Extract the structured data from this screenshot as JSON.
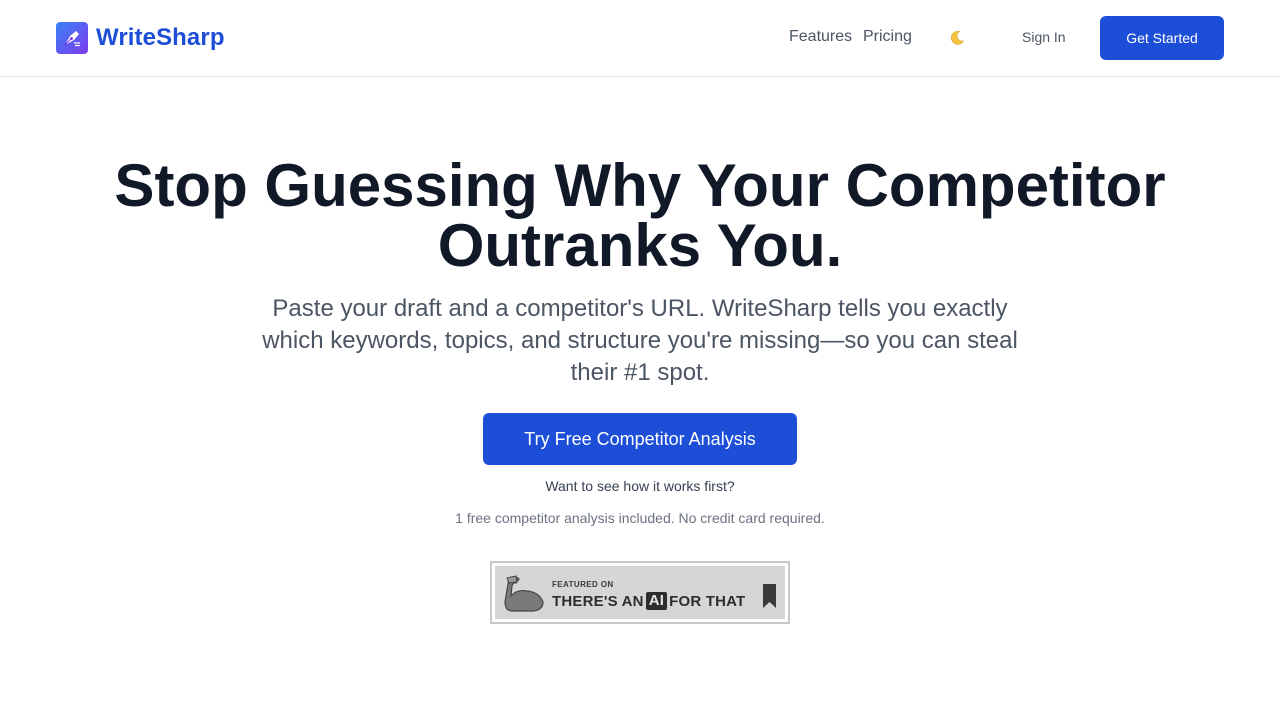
{
  "header": {
    "brand_name": "WriteSharp",
    "nav": {
      "features": "Features",
      "pricing": "Pricing"
    },
    "theme_toggle_icon": "moon-icon",
    "sign_in": "Sign In",
    "get_started": "Get Started"
  },
  "hero": {
    "title": "Stop Guessing Why Your Competitor Outranks You.",
    "subtitle": "Paste your draft and a competitor's URL. WriteSharp tells you exactly which keywords, topics, and structure you're missing—so you can steal their #1 spot.",
    "cta": "Try Free Competitor Analysis",
    "demo_link": "Want to see how it works first?",
    "fineprint": "1 free competitor analysis included. No credit card required."
  },
  "badge": {
    "featured_on": "FEATURED ON",
    "line_before": "THERE'S AN",
    "ai": "AI",
    "line_after": "FOR THAT"
  },
  "colors": {
    "brand": "#1d4ed8",
    "heading": "#111827",
    "muted": "#4b5563"
  }
}
